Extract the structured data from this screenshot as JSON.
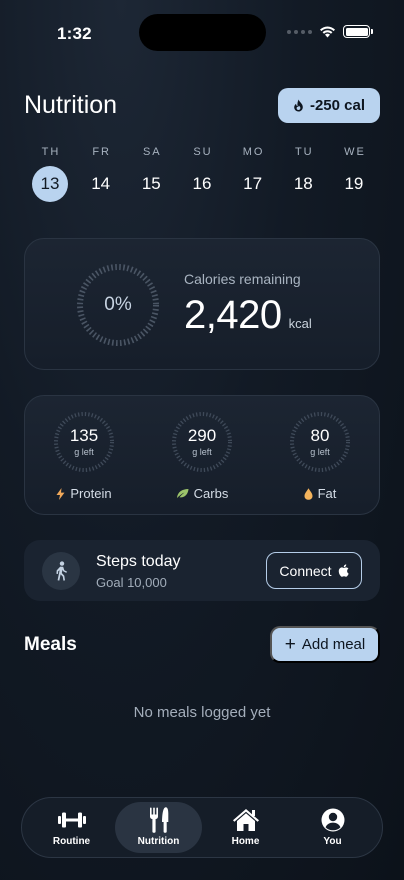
{
  "status": {
    "time": "1:32"
  },
  "header": {
    "title": "Nutrition",
    "calorie_badge": "-250 cal"
  },
  "week": [
    {
      "label": "TH",
      "num": "13",
      "selected": true
    },
    {
      "label": "FR",
      "num": "14"
    },
    {
      "label": "SA",
      "num": "15"
    },
    {
      "label": "SU",
      "num": "16"
    },
    {
      "label": "MO",
      "num": "17"
    },
    {
      "label": "TU",
      "num": "18"
    },
    {
      "label": "WE",
      "num": "19"
    }
  ],
  "calories": {
    "percent": "0%",
    "progress": 0,
    "caption": "Calories remaining",
    "value": "2,420",
    "unit": "kcal"
  },
  "macros": [
    {
      "value": "135",
      "sub": "g left",
      "name": "Protein",
      "icon": "lightning-icon",
      "color": "#f0a85a"
    },
    {
      "value": "290",
      "sub": "g left",
      "name": "Carbs",
      "icon": "leaf-icon",
      "color": "#9cc46b"
    },
    {
      "value": "80",
      "sub": "g left",
      "name": "Fat",
      "icon": "drop-icon",
      "color": "#f3b35c"
    }
  ],
  "steps": {
    "title": "Steps today",
    "goal": "Goal 10,000",
    "connect_label": "Connect"
  },
  "meals": {
    "title": "Meals",
    "add_label": "Add meal",
    "empty": "No meals logged yet"
  },
  "tabs": [
    {
      "label": "Routine",
      "icon": "dumbbell-icon"
    },
    {
      "label": "Nutrition",
      "icon": "fork-knife-icon",
      "active": true
    },
    {
      "label": "Home",
      "icon": "home-icon"
    },
    {
      "label": "You",
      "icon": "person-circle-icon"
    }
  ],
  "colors": {
    "accent": "#b9d3ef",
    "background": "#121a25",
    "card": "#1a2330"
  }
}
